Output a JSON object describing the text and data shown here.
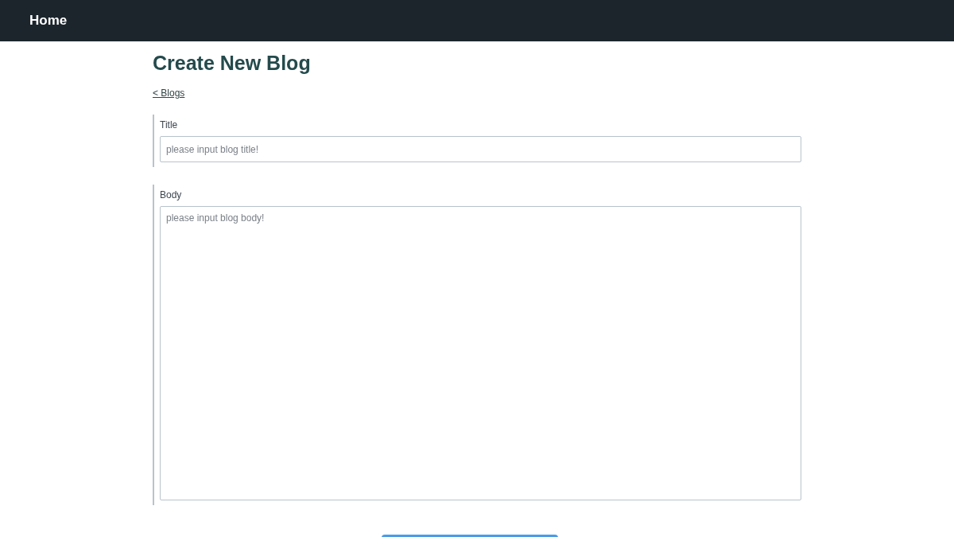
{
  "navbar": {
    "brand": "Home"
  },
  "page": {
    "heading": "Create New Blog",
    "back_link": "< Blogs"
  },
  "fields": [
    {
      "kind": "input",
      "label": "Title",
      "placeholder": "please input blog title!"
    },
    {
      "kind": "textarea",
      "label": "Body",
      "placeholder": "please input blog body!"
    }
  ]
}
